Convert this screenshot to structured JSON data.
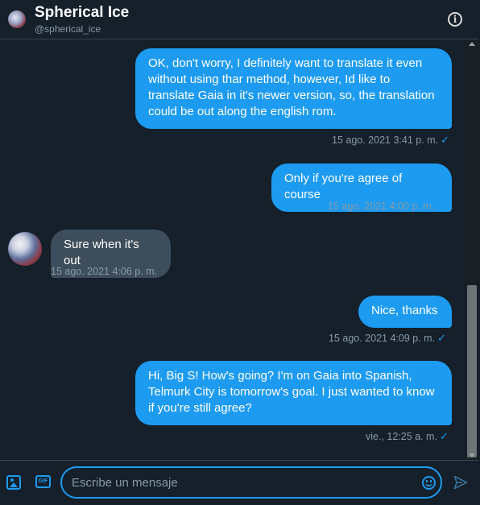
{
  "header": {
    "name": "Spherical Ice",
    "handle": "@spherical_ice"
  },
  "messages": [
    {
      "direction": "out",
      "text": "OK, don't worry, I definitely want to translate it even without using thar method, however, Id like to translate Gaia in it's newer version, so, the translation could be out along the english rom.",
      "time": "15 ago. 2021 3:41 p. m."
    },
    {
      "direction": "out",
      "text": "Only if you're agree of course",
      "time": "15 ago. 2021 4:00 p. m."
    },
    {
      "direction": "in",
      "text": "Sure when it's out",
      "time": "15 ago. 2021 4:06 p. m."
    },
    {
      "direction": "out",
      "text": "Nice, thanks",
      "time": "15 ago. 2021 4:09 p. m."
    },
    {
      "direction": "out",
      "text": "Hi, Big S! How's going? I'm on Gaia into Spanish, Telmurk City is tomorrow's goal. I just wanted to know if you're still agree?",
      "time": "vie., 12:25 a. m."
    }
  ],
  "composer": {
    "placeholder": "Escribe un mensaje",
    "gif_label": "GIF"
  },
  "icons": {
    "header_info": "info-icon",
    "media": "image-icon",
    "gif": "gif-icon",
    "emoji": "emoji-icon",
    "send": "send-icon",
    "read_receipt": "check-icon"
  },
  "colors": {
    "background": "#15202b",
    "accent": "#1d9bf0",
    "incoming_bubble": "#3d4d5c",
    "muted_text": "#8899a6"
  }
}
